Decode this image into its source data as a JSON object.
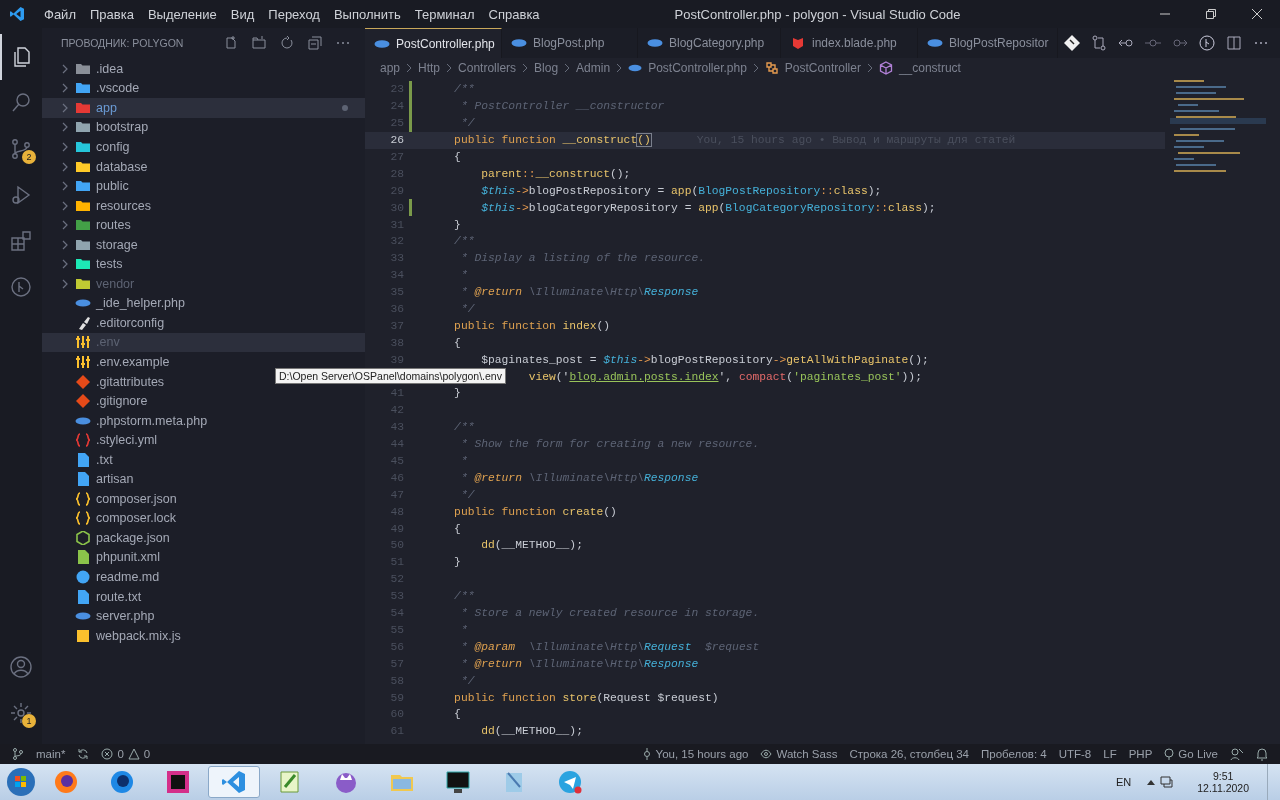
{
  "window": {
    "title": "PostController.php - polygon - Visual Studio Code"
  },
  "menu": [
    "Файл",
    "Правка",
    "Выделение",
    "Вид",
    "Переход",
    "Выполнить",
    "Терминал",
    "Справка"
  ],
  "activity_bar": {
    "items": [
      {
        "kind": "files",
        "selected": true
      },
      {
        "kind": "search",
        "selected": false
      },
      {
        "kind": "scm",
        "selected": false,
        "badge": "2"
      },
      {
        "kind": "run",
        "selected": false
      },
      {
        "kind": "extensions",
        "selected": false
      },
      {
        "kind": "gitlens",
        "selected": false
      }
    ],
    "bottom": [
      {
        "kind": "account"
      },
      {
        "kind": "settings",
        "badge": "1"
      }
    ]
  },
  "sidebar": {
    "title": "ПРОВОДНИК: POLYGON",
    "items": [
      {
        "label": ".idea",
        "kind": "folder",
        "color": "#8a8f98",
        "expanded": false,
        "modified": false,
        "dimmed": false,
        "hovered": false
      },
      {
        "label": ".vscode",
        "kind": "folder",
        "color": "#42a5f5",
        "expanded": false,
        "modified": false,
        "dimmed": false,
        "hovered": false
      },
      {
        "label": "app",
        "kind": "folder",
        "color": "#e53935",
        "expanded": false,
        "modified": true,
        "dimmed": false,
        "hovered": true
      },
      {
        "label": "bootstrap",
        "kind": "folder",
        "color": "#90a4ae",
        "expanded": false,
        "modified": false,
        "dimmed": false,
        "hovered": false
      },
      {
        "label": "config",
        "kind": "folder",
        "color": "#26c6da",
        "expanded": false,
        "modified": false,
        "dimmed": false,
        "hovered": false
      },
      {
        "label": "database",
        "kind": "folder",
        "color": "#ffca28",
        "expanded": false,
        "modified": false,
        "dimmed": false,
        "hovered": false
      },
      {
        "label": "public",
        "kind": "folder",
        "color": "#42a5f5",
        "expanded": false,
        "modified": false,
        "dimmed": false,
        "hovered": false
      },
      {
        "label": "resources",
        "kind": "folder",
        "color": "#ffb300",
        "expanded": false,
        "modified": false,
        "dimmed": false,
        "hovered": false
      },
      {
        "label": "routes",
        "kind": "folder",
        "color": "#43a047",
        "expanded": false,
        "modified": false,
        "dimmed": false,
        "hovered": false
      },
      {
        "label": "storage",
        "kind": "folder",
        "color": "#90a4ae",
        "expanded": false,
        "modified": false,
        "dimmed": false,
        "hovered": false
      },
      {
        "label": "tests",
        "kind": "folder",
        "color": "#1de9b6",
        "expanded": false,
        "modified": false,
        "dimmed": false,
        "hovered": false
      },
      {
        "label": "vendor",
        "kind": "folder",
        "color": "#c0ca33",
        "expanded": false,
        "modified": false,
        "dimmed": true,
        "hovered": false
      },
      {
        "label": "_ide_helper.php",
        "kind": "php",
        "color": "#4a8fe0",
        "modified": false,
        "dimmed": false,
        "hovered": false
      },
      {
        "label": ".editorconfig",
        "kind": "tool",
        "color": "#e0e0e0",
        "modified": false,
        "dimmed": false,
        "hovered": false
      },
      {
        "label": ".env",
        "kind": "env",
        "color": "#fbc02d",
        "modified": false,
        "dimmed": true,
        "hovered": true
      },
      {
        "label": ".env.example",
        "kind": "env",
        "color": "#fbc02d",
        "modified": false,
        "dimmed": false,
        "hovered": false
      },
      {
        "label": ".gitattributes",
        "kind": "git",
        "color": "#e64a19",
        "modified": false,
        "dimmed": false,
        "hovered": false
      },
      {
        "label": ".gitignore",
        "kind": "git",
        "color": "#e64a19",
        "modified": false,
        "dimmed": false,
        "hovered": false
      },
      {
        "label": ".phpstorm.meta.php",
        "kind": "php",
        "color": "#4a8fe0",
        "modified": false,
        "dimmed": false,
        "hovered": false
      },
      {
        "label": ".styleci.yml",
        "kind": "braces",
        "color": "#e53935",
        "modified": false,
        "dimmed": false,
        "hovered": false
      },
      {
        "label": ".txt",
        "kind": "doc",
        "color": "#42a5f5",
        "modified": false,
        "dimmed": false,
        "hovered": false
      },
      {
        "label": "artisan",
        "kind": "doc",
        "color": "#42a5f5",
        "modified": false,
        "dimmed": false,
        "hovered": false
      },
      {
        "label": "composer.json",
        "kind": "braces",
        "color": "#fbc02d",
        "modified": false,
        "dimmed": false,
        "hovered": false
      },
      {
        "label": "composer.lock",
        "kind": "braces",
        "color": "#fbc02d",
        "modified": false,
        "dimmed": false,
        "hovered": false
      },
      {
        "label": "package.json",
        "kind": "hex",
        "color": "#8bc34a",
        "modified": false,
        "dimmed": false,
        "hovered": false
      },
      {
        "label": "phpunit.xml",
        "kind": "doc",
        "color": "#8bc34a",
        "modified": false,
        "dimmed": false,
        "hovered": false
      },
      {
        "label": "readme.md",
        "kind": "info",
        "color": "#42a5f5",
        "modified": false,
        "dimmed": false,
        "hovered": false
      },
      {
        "label": "route.txt",
        "kind": "doc",
        "color": "#42a5f5",
        "modified": false,
        "dimmed": false,
        "hovered": false
      },
      {
        "label": "server.php",
        "kind": "php",
        "color": "#4a8fe0",
        "modified": false,
        "dimmed": false,
        "hovered": false
      },
      {
        "label": "webpack.mix.js",
        "kind": "js",
        "color": "#fbc02d",
        "modified": false,
        "dimmed": false,
        "hovered": false
      }
    ]
  },
  "tabs": [
    {
      "label": "PostController.php",
      "kind": "php",
      "color": "#4a8fe0",
      "selected": true
    },
    {
      "label": "BlogPost.php",
      "kind": "php",
      "color": "#4a8fe0",
      "selected": false
    },
    {
      "label": "BlogCategory.php",
      "kind": "php",
      "color": "#4a8fe0",
      "selected": false
    },
    {
      "label": "index.blade.php",
      "kind": "blade",
      "color": "#e53935",
      "selected": false
    },
    {
      "label": "BlogPostRepositor",
      "kind": "php",
      "color": "#4a8fe0",
      "selected": false
    }
  ],
  "breadcrumbs": [
    {
      "label": "app",
      "kind": "plain"
    },
    {
      "label": "Http",
      "kind": "plain"
    },
    {
      "label": "Controllers",
      "kind": "plain"
    },
    {
      "label": "Blog",
      "kind": "plain"
    },
    {
      "label": "Admin",
      "kind": "plain"
    },
    {
      "label": "PostController.php",
      "kind": "php"
    },
    {
      "label": "PostController",
      "kind": "class"
    },
    {
      "label": "__construct",
      "kind": "method"
    }
  ],
  "code": [
    {
      "n": "23",
      "changed": true,
      "current": false,
      "tokens": [
        {
          "text": "    /**",
          "kind": "comment"
        }
      ]
    },
    {
      "n": "24",
      "changed": true,
      "current": false,
      "tokens": [
        {
          "text": "     * PostController __constructor",
          "kind": "comment"
        }
      ]
    },
    {
      "n": "25",
      "changed": true,
      "current": false,
      "tokens": [
        {
          "text": "     */",
          "kind": "comment"
        }
      ]
    },
    {
      "n": "26",
      "changed": false,
      "current": true,
      "tokens": [
        {
          "text": "    public function ",
          "kind": "keyword"
        },
        {
          "text": "__construct",
          "kind": "function"
        },
        {
          "text": "()",
          "kind": "bracket-match"
        }
      ],
      "blame": "You, 15 hours ago • Вывод и маршруты для статей"
    },
    {
      "n": "27",
      "changed": false,
      "current": false,
      "tokens": [
        {
          "text": "    {",
          "kind": "plain"
        }
      ]
    },
    {
      "n": "28",
      "changed": false,
      "current": false,
      "tokens": [
        {
          "text": "        parent",
          "kind": "function"
        },
        {
          "text": "::",
          "kind": "operator"
        },
        {
          "text": "__construct",
          "kind": "function"
        },
        {
          "text": "();",
          "kind": "plain"
        }
      ]
    },
    {
      "n": "29",
      "changed": false,
      "current": false,
      "tokens": [
        {
          "text": "        $this",
          "kind": "variable"
        },
        {
          "text": "->",
          "kind": "operator"
        },
        {
          "text": "blogPostRepository = ",
          "kind": "plain"
        },
        {
          "text": "app",
          "kind": "function"
        },
        {
          "text": "(",
          "kind": "plain"
        },
        {
          "text": "BlogPostRepository",
          "kind": "class"
        },
        {
          "text": "::",
          "kind": "operator"
        },
        {
          "text": "class",
          "kind": "function"
        },
        {
          "text": ");",
          "kind": "plain"
        }
      ]
    },
    {
      "n": "30",
      "changed": true,
      "current": false,
      "tokens": [
        {
          "text": "        $this",
          "kind": "variable"
        },
        {
          "text": "->",
          "kind": "operator"
        },
        {
          "text": "blogCategoryRepository = ",
          "kind": "plain"
        },
        {
          "text": "app",
          "kind": "function"
        },
        {
          "text": "(",
          "kind": "plain"
        },
        {
          "text": "BlogCategoryRepository",
          "kind": "class"
        },
        {
          "text": "::",
          "kind": "operator"
        },
        {
          "text": "class",
          "kind": "function"
        },
        {
          "text": ");",
          "kind": "plain"
        }
      ]
    },
    {
      "n": "31",
      "changed": false,
      "current": false,
      "tokens": [
        {
          "text": "    }",
          "kind": "plain"
        }
      ]
    },
    {
      "n": "32",
      "changed": false,
      "current": false,
      "tokens": [
        {
          "text": "    /**",
          "kind": "comment"
        }
      ]
    },
    {
      "n": "33",
      "changed": false,
      "current": false,
      "tokens": [
        {
          "text": "     * Display a listing of the resource.",
          "kind": "comment"
        }
      ]
    },
    {
      "n": "34",
      "changed": false,
      "current": false,
      "tokens": [
        {
          "text": "     *",
          "kind": "comment"
        }
      ]
    },
    {
      "n": "35",
      "changed": false,
      "current": false,
      "tokens": [
        {
          "text": "     * ",
          "kind": "comment"
        },
        {
          "text": "@return",
          "kind": "doc-tag"
        },
        {
          "text": " \\Illuminate\\Http\\",
          "kind": "comment"
        },
        {
          "text": "Response",
          "kind": "doc-type"
        }
      ]
    },
    {
      "n": "36",
      "changed": false,
      "current": false,
      "tokens": [
        {
          "text": "     */",
          "kind": "comment"
        }
      ]
    },
    {
      "n": "37",
      "changed": false,
      "current": false,
      "tokens": [
        {
          "text": "    public function ",
          "kind": "keyword"
        },
        {
          "text": "index",
          "kind": "function"
        },
        {
          "text": "()",
          "kind": "plain"
        }
      ]
    },
    {
      "n": "38",
      "changed": false,
      "current": false,
      "tokens": [
        {
          "text": "    {",
          "kind": "plain"
        }
      ]
    },
    {
      "n": "39",
      "changed": false,
      "current": false,
      "tokens": [
        {
          "text": "        $paginates_post = ",
          "kind": "plain"
        },
        {
          "text": "$this",
          "kind": "variable"
        },
        {
          "text": "->",
          "kind": "operator"
        },
        {
          "text": "blogPostRepository",
          "kind": "plain"
        },
        {
          "text": "->",
          "kind": "operator"
        },
        {
          "text": "getAllWithPaginate",
          "kind": "function"
        },
        {
          "text": "();",
          "kind": "plain"
        }
      ]
    },
    {
      "changed": false,
      "current": false,
      "tokens": [
        {
          "text": "               view",
          "kind": "function"
        },
        {
          "text": "('",
          "kind": "plain"
        },
        {
          "text": "blog.admin.posts.index",
          "kind": "string-link"
        },
        {
          "text": "', ",
          "kind": "plain"
        },
        {
          "text": "compact",
          "kind": "builtin"
        },
        {
          "text": "(",
          "kind": "plain"
        },
        {
          "text": "'paginates_post'",
          "kind": "string"
        },
        {
          "text": "));",
          "kind": "plain"
        }
      ]
    },
    {
      "n": "41",
      "changed": false,
      "current": false,
      "tokens": [
        {
          "text": "    }",
          "kind": "plain"
        }
      ]
    },
    {
      "n": "42",
      "changed": false,
      "current": false
    },
    {
      "n": "43",
      "changed": false,
      "current": false,
      "tokens": [
        {
          "text": "    /**",
          "kind": "comment"
        }
      ]
    },
    {
      "n": "44",
      "changed": false,
      "current": false,
      "tokens": [
        {
          "text": "     * Show the form for creating a new resource.",
          "kind": "comment"
        }
      ]
    },
    {
      "n": "45",
      "changed": false,
      "current": false,
      "tokens": [
        {
          "text": "     *",
          "kind": "comment"
        }
      ]
    },
    {
      "n": "46",
      "changed": false,
      "current": false,
      "tokens": [
        {
          "text": "     * ",
          "kind": "comment"
        },
        {
          "text": "@return",
          "kind": "doc-tag"
        },
        {
          "text": " \\Illuminate\\Http\\",
          "kind": "comment"
        },
        {
          "text": "Response",
          "kind": "doc-type"
        }
      ]
    },
    {
      "n": "47",
      "changed": false,
      "current": false,
      "tokens": [
        {
          "text": "     */",
          "kind": "comment"
        }
      ]
    },
    {
      "n": "48",
      "changed": false,
      "current": false,
      "tokens": [
        {
          "text": "    public function ",
          "kind": "keyword"
        },
        {
          "text": "create",
          "kind": "function"
        },
        {
          "text": "()",
          "kind": "plain"
        }
      ]
    },
    {
      "n": "49",
      "changed": false,
      "current": false,
      "tokens": [
        {
          "text": "    {",
          "kind": "plain"
        }
      ]
    },
    {
      "n": "50",
      "changed": false,
      "current": false,
      "tokens": [
        {
          "text": "        dd",
          "kind": "function"
        },
        {
          "text": "(__METHOD__);",
          "kind": "plain"
        }
      ]
    },
    {
      "n": "51",
      "changed": false,
      "current": false,
      "tokens": [
        {
          "text": "    }",
          "kind": "plain"
        }
      ]
    },
    {
      "n": "52",
      "changed": false,
      "current": false
    },
    {
      "n": "53",
      "changed": false,
      "current": false,
      "tokens": [
        {
          "text": "    /**",
          "kind": "comment"
        }
      ]
    },
    {
      "n": "54",
      "changed": false,
      "current": false,
      "tokens": [
        {
          "text": "     * Store a newly created resource in storage.",
          "kind": "comment"
        }
      ]
    },
    {
      "n": "55",
      "changed": false,
      "current": false,
      "tokens": [
        {
          "text": "     *",
          "kind": "comment"
        }
      ]
    },
    {
      "n": "56",
      "changed": false,
      "current": false,
      "tokens": [
        {
          "text": "     * ",
          "kind": "comment"
        },
        {
          "text": "@param",
          "kind": "doc-tag"
        },
        {
          "text": "  \\Illuminate\\Http\\",
          "kind": "comment"
        },
        {
          "text": "Request",
          "kind": "doc-type"
        },
        {
          "text": "  $request",
          "kind": "comment"
        }
      ]
    },
    {
      "n": "57",
      "changed": false,
      "current": false,
      "tokens": [
        {
          "text": "     * ",
          "kind": "comment"
        },
        {
          "text": "@return",
          "kind": "doc-tag"
        },
        {
          "text": " \\Illuminate\\Http\\",
          "kind": "comment"
        },
        {
          "text": "Response",
          "kind": "doc-type"
        }
      ]
    },
    {
      "n": "58",
      "changed": false,
      "current": false,
      "tokens": [
        {
          "text": "     */",
          "kind": "comment"
        }
      ]
    },
    {
      "n": "59",
      "changed": false,
      "current": false,
      "tokens": [
        {
          "text": "    public function ",
          "kind": "keyword"
        },
        {
          "text": "store",
          "kind": "function"
        },
        {
          "text": "(Request $request)",
          "kind": "plain"
        }
      ]
    },
    {
      "n": "60",
      "changed": false,
      "current": false,
      "tokens": [
        {
          "text": "    {",
          "kind": "plain"
        }
      ]
    },
    {
      "n": "61",
      "changed": false,
      "current": false,
      "tokens": [
        {
          "text": "        dd",
          "kind": "function"
        },
        {
          "text": "(__METHOD__);",
          "kind": "plain"
        }
      ]
    }
  ],
  "tooltip": "D:\\Open Server\\OSPanel\\domains\\polygon\\.env",
  "status_bar": {
    "branch": "main*",
    "errors": "0",
    "warnings": "0",
    "right": [
      {
        "label": "You, 15 hours ago",
        "kind": "git"
      },
      {
        "label": "Watch Sass",
        "kind": "eye"
      },
      {
        "label": "Строка 26, столбец 34",
        "kind": "plain"
      },
      {
        "label": "Пробелов: 4",
        "kind": "plain"
      },
      {
        "label": "UTF-8",
        "kind": "plain"
      },
      {
        "label": "LF",
        "kind": "plain"
      },
      {
        "label": "PHP",
        "kind": "plain"
      },
      {
        "label": "Go Live",
        "kind": "live"
      }
    ]
  },
  "taskbar": {
    "apps": [
      {
        "kind": "firefox",
        "selected": false
      },
      {
        "kind": "firefox-dev",
        "selected": false
      },
      {
        "kind": "phpstorm",
        "selected": false
      },
      {
        "kind": "vscode",
        "selected": true
      },
      {
        "kind": "notepadpp",
        "selected": false
      },
      {
        "kind": "cat",
        "selected": false
      },
      {
        "kind": "explorer",
        "selected": false
      },
      {
        "kind": "terminal",
        "selected": false
      },
      {
        "kind": "notepad",
        "selected": false
      },
      {
        "kind": "telegram",
        "selected": false
      }
    ],
    "language": "EN",
    "time": "9:51",
    "date": "12.11.2020"
  }
}
